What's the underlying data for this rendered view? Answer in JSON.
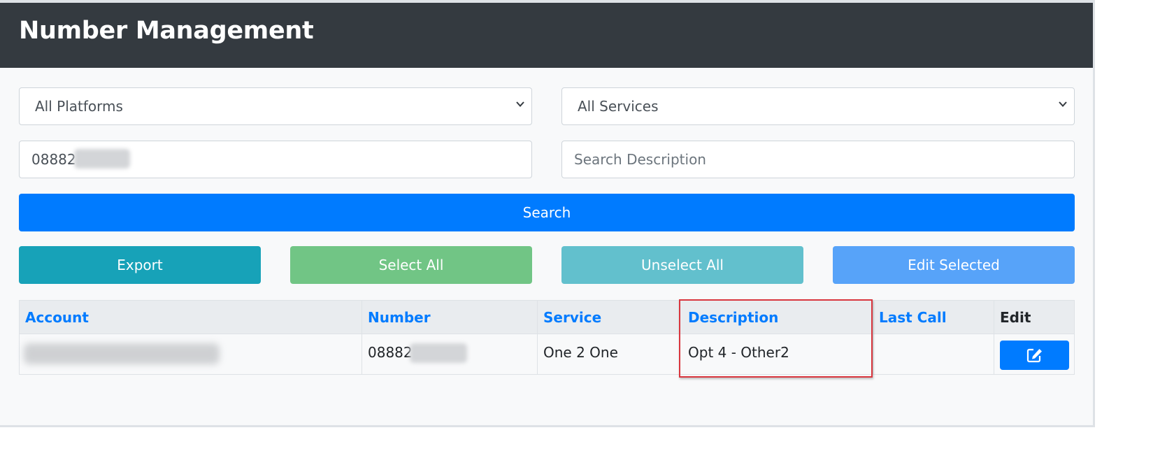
{
  "header": {
    "title": "Number Management"
  },
  "filters": {
    "platform_select": {
      "value": "All Platforms"
    },
    "service_select": {
      "value": "All Services"
    },
    "number_input": {
      "value": "08882"
    },
    "description_input": {
      "value": "",
      "placeholder": "Search Description"
    }
  },
  "buttons": {
    "search": "Search",
    "export": "Export",
    "select_all": "Select All",
    "unselect_all": "Unselect All",
    "edit_selected": "Edit Selected"
  },
  "table": {
    "headers": {
      "account": "Account",
      "number": "Number",
      "service": "Service",
      "description": "Description",
      "last_call": "Last Call",
      "edit": "Edit"
    },
    "rows": [
      {
        "account": "",
        "number": "08882",
        "service": "One 2 One",
        "description": "Opt 4 - Other2",
        "last_call": ""
      }
    ]
  },
  "icons": {
    "select_chevron": "chevron-down-icon",
    "edit": "edit-icon"
  },
  "colors": {
    "header_bg": "#343a40",
    "primary": "#007bff",
    "info": "#17a2b8",
    "success_light": "#71c585",
    "info_light": "#62c0cd",
    "primary_light": "#57a3f9",
    "highlight": "#d9363e"
  }
}
